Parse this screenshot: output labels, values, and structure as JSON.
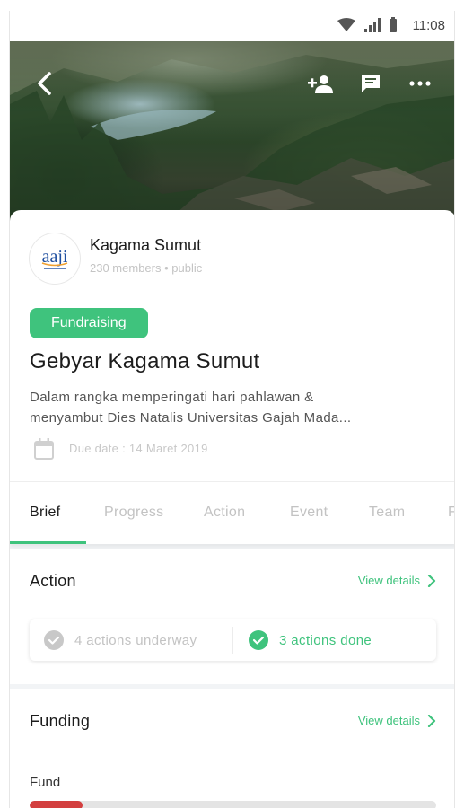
{
  "status_bar": {
    "time": "11:08"
  },
  "header": {
    "icons": [
      "back-arrow-icon",
      "add-member-icon",
      "chat-icon",
      "more-icon"
    ]
  },
  "group": {
    "logo_text": "aaji",
    "name": "Kagama Sumut",
    "meta": "230 members • public"
  },
  "campaign": {
    "tag": "Fundraising",
    "title": "Gebyar Kagama Sumut",
    "description_lines": [
      "Dalam rangka memperingati hari pahlawan &",
      "menyambut Dies Natalis Universitas Gajah Mada..."
    ],
    "due_date": "Due date : 14 Maret 2019"
  },
  "tabs": [
    {
      "label": "Brief",
      "active": true
    },
    {
      "label": "Progress",
      "active": false
    },
    {
      "label": "Action",
      "active": false
    },
    {
      "label": "Event",
      "active": false
    },
    {
      "label": "Team",
      "active": false
    },
    {
      "label": "F",
      "active": false
    }
  ],
  "action_section": {
    "title": "Action",
    "view_details": "View details",
    "underway": "4 actions underway",
    "done": "3 actions done"
  },
  "funding_section": {
    "title": "Funding",
    "view_details": "View details",
    "fund_label": "Fund",
    "fund_progress": 0.13
  },
  "colors": {
    "accent": "#3fc37d",
    "progress_fill": "#d33f3f",
    "progress_track": "#e4e4e4",
    "muted_text": "#c3c3c3"
  }
}
